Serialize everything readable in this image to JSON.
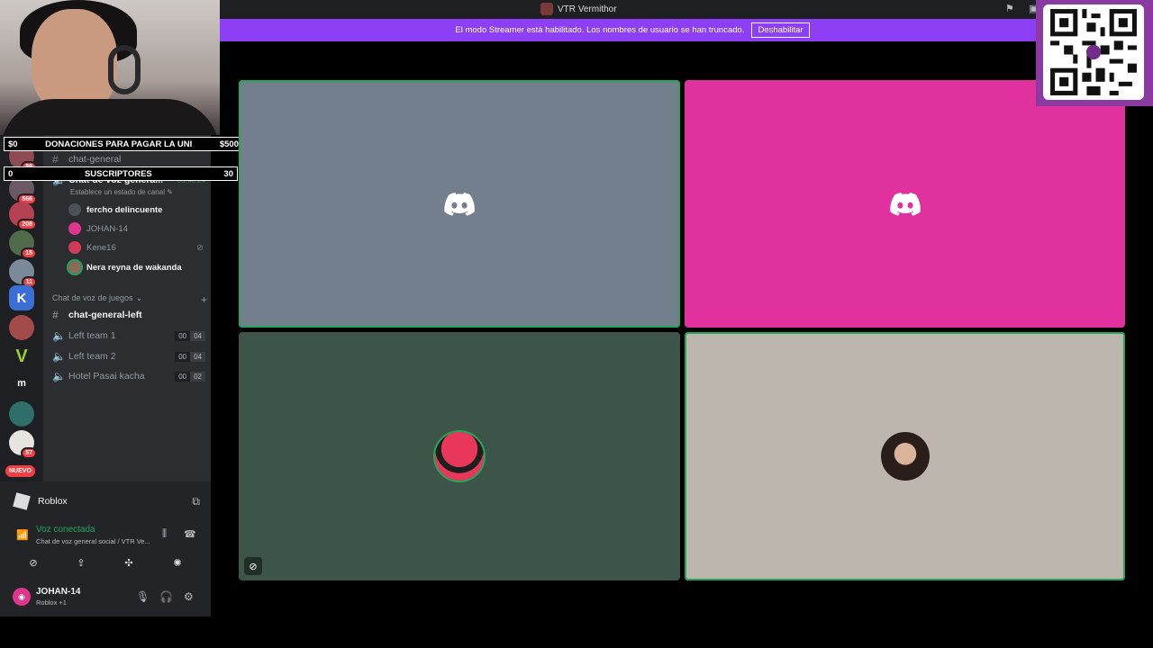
{
  "titlebar": {
    "title": "VTR Vermithor"
  },
  "banner": {
    "text": "El modo Streamer está habilitado. Los nombres de usuario se han truncado.",
    "button": "Deshabilitar"
  },
  "overlays": {
    "donations": {
      "left": "$0",
      "label": "DONACIONES PARA PAGAR LA UNI",
      "right": "$500"
    },
    "subs": {
      "left": "0",
      "label": "SUSCRIPTORES",
      "right": "30"
    }
  },
  "servers": {
    "badges": [
      "59",
      "566",
      "208",
      "15",
      "11",
      "57"
    ],
    "letters": {
      "k": "K",
      "v": "V",
      "m": "m"
    },
    "nuevo": "NUEVO"
  },
  "channels": {
    "chat_general": "chat-general",
    "voice_general": "Chat de voz genera...",
    "voice_timer": "03:48:24",
    "status_hint": "Establece un estado de canal",
    "users": [
      "fercho delincuente",
      "JOHAN-14",
      "Kene16",
      "Nera reyna de wakanda"
    ],
    "category": "Chat de voz de juegos",
    "list": [
      {
        "name": "chat-general-left"
      },
      {
        "name": "Left team 1",
        "a": "00",
        "b": "04"
      },
      {
        "name": "Left team 2",
        "a": "00",
        "b": "04"
      },
      {
        "name": "Hotel Pasai kacha",
        "a": "00",
        "b": "02"
      }
    ]
  },
  "activity": {
    "game": "Roblox"
  },
  "voice": {
    "status": "Voz conectada",
    "location": "Chat de voz general social / VTR Ve..."
  },
  "user": {
    "name": "JOHAN-14",
    "activity": "Roblox +1"
  },
  "colors": {
    "blurple": "#5865f2",
    "tile_gray": "#747f8d",
    "tile_pink": "#e1319e",
    "tile_green": "#3d5549",
    "tile_beige": "#bcb6ae",
    "online": "#23a55a",
    "banner": "#8c3ff5"
  }
}
